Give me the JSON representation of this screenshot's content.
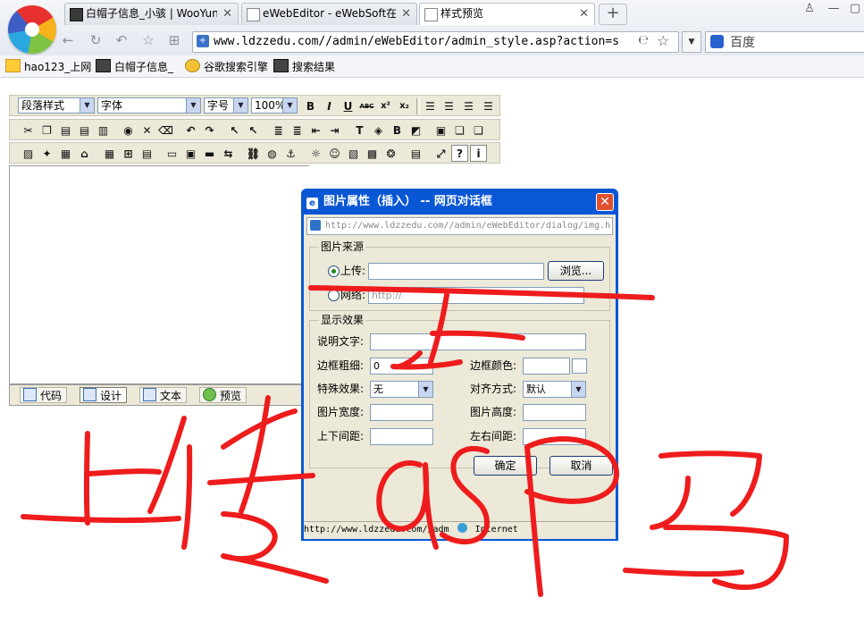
{
  "browser": {
    "tabs": [
      {
        "label": "白帽子信息_小骇 | WooYun"
      },
      {
        "label": "eWebEditor - eWebSoft在线"
      },
      {
        "label": "样式预览"
      }
    ],
    "new_tab": "+",
    "address": "www.ldzzedu.com//admin/eWebEditor/admin_style.asp?action=s",
    "search_placeholder": "百度",
    "bookmarks": [
      {
        "label": "hao123_上网"
      },
      {
        "label": "白帽子信息_"
      },
      {
        "label": "谷歌搜索引擎"
      },
      {
        "label": "搜索结果"
      }
    ]
  },
  "editor": {
    "paragraph_style": "段落样式",
    "font": "字体",
    "font_size": "字号",
    "zoom": "100%",
    "format_buttons": [
      "B",
      "I",
      "U",
      "ABC",
      "x²",
      "x₂"
    ],
    "modes": [
      {
        "label": "代码"
      },
      {
        "label": "设计"
      },
      {
        "label": "文本"
      },
      {
        "label": "预览"
      }
    ]
  },
  "dialog": {
    "title": "图片属性（插入） -- 网页对话框",
    "close_glyph": "✕",
    "url": "http://www.ldzzedu.com//admin/eWebEditor/dialog/img.h",
    "source_group": "图片来源",
    "upload_label": "上传:",
    "browse_button": "浏览...",
    "network_label": "网络:",
    "network_value": "http://",
    "effects_group": "显示效果",
    "alt_label": "说明文字:",
    "border_label": "边框粗细:",
    "border_value": "0",
    "border_color_label": "边框颜色:",
    "special_label": "特殊效果:",
    "special_value": "无",
    "align_label": "对齐方式:",
    "align_value": "默认",
    "width_label": "图片宽度:",
    "height_label": "图片高度:",
    "vspace_label": "上下间距:",
    "hspace_label": "左右间距:",
    "ok_button": "确定",
    "cancel_button": "取消",
    "status": "http://www.ldzzedu.com//adm",
    "status_zone": "Internet"
  }
}
